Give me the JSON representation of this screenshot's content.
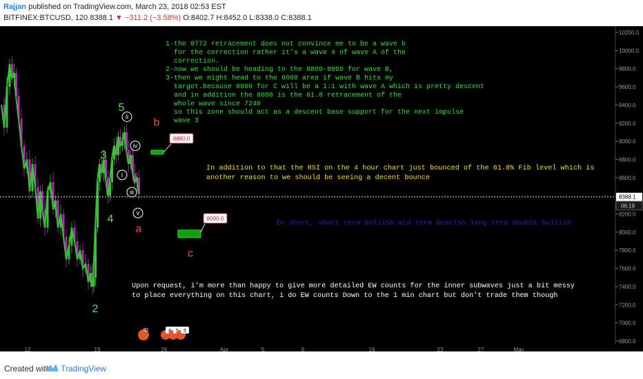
{
  "header": {
    "author": "Rajjan",
    "published": "published on TradingView.com, March 23, 2018 02:53 EST",
    "symbol": "BITFINEX:BTCUSD, 120",
    "last": "8388.1",
    "change": "−311.2 (−3.58%)",
    "ohlc": "O:8402.7 H:8452.0 L:8338.0 C:8388.1"
  },
  "footer": {
    "created_with": "Created with",
    "brand": "TradingView"
  },
  "colors": {
    "background": "#000000",
    "price_line": "#34c334",
    "wave_label": "#55e055",
    "red_label": "#ff4040",
    "note_green": "#33e333",
    "note_yellow": "#f2e21a",
    "note_blue": "#2222cc",
    "note_white": "#ffffff",
    "box_green": "#10a010"
  },
  "chart_data": {
    "type": "line",
    "title": "",
    "y_axis": {
      "ylim": [
        6800,
        10200
      ],
      "tick_labels": [
        "10200.0",
        "10000.0",
        "9800.0",
        "9600.0",
        "9400.0",
        "9200.0",
        "9000.0",
        "8800.0",
        "8600.0",
        "8400.0",
        "8200.0",
        "8000.0",
        "7800.0",
        "7600.0",
        "7400.0",
        "7200.0",
        "7000.0",
        "6800.0"
      ],
      "current_price_label": "8388.1",
      "countdown_label": "06:19"
    },
    "x_axis": {
      "tick_labels": [
        "12",
        "19",
        "26",
        "Apr",
        "5",
        "9",
        "16",
        "23",
        "27",
        "May"
      ]
    },
    "current_price": 8388.1,
    "series": [
      {
        "values": [
          [
            2,
            9400
          ],
          [
            6,
            9150
          ],
          [
            10,
            9600
          ],
          [
            14,
            9850
          ],
          [
            17,
            9700
          ],
          [
            20,
            9750
          ],
          [
            23,
            9500
          ],
          [
            27,
            9250
          ],
          [
            31,
            8950
          ],
          [
            35,
            8700
          ],
          [
            39,
            8800
          ],
          [
            43,
            8450
          ],
          [
            47,
            8750
          ],
          [
            51,
            8500
          ],
          [
            55,
            8150
          ],
          [
            58,
            8450
          ],
          [
            61,
            8250
          ],
          [
            65,
            8050
          ],
          [
            69,
            8450
          ],
          [
            73,
            8550
          ],
          [
            77,
            8250
          ],
          [
            80,
            8350
          ],
          [
            84,
            8050
          ],
          [
            88,
            8200
          ],
          [
            92,
            7950
          ],
          [
            96,
            7700
          ],
          [
            100,
            7850
          ],
          [
            104,
            8050
          ],
          [
            108,
            7900
          ],
          [
            112,
            7700
          ],
          [
            116,
            7800
          ],
          [
            120,
            7600
          ],
          [
            124,
            7650
          ],
          [
            128,
            7450
          ],
          [
            131,
            7550
          ],
          [
            133,
            7400
          ],
          [
            135,
            7500
          ],
          [
            138,
            8050
          ],
          [
            141,
            8550
          ],
          [
            144,
            8750
          ],
          [
            147,
            8650
          ],
          [
            150,
            8800
          ],
          [
            153,
            8600
          ],
          [
            156,
            8400
          ],
          [
            159,
            8550
          ],
          [
            162,
            8800
          ],
          [
            165,
            8950
          ],
          [
            168,
            8850
          ],
          [
            171,
            9050
          ],
          [
            174,
            8950
          ],
          [
            177,
            9000
          ],
          [
            180,
            9100
          ],
          [
            183,
            8900
          ],
          [
            186,
            8750
          ],
          [
            189,
            8850
          ],
          [
            192,
            8650
          ],
          [
            195,
            8550
          ],
          [
            198,
            8600
          ],
          [
            201,
            8420
          ]
        ]
      }
    ],
    "wave_labels": [
      {
        "text": "5",
        "price": 9335,
        "style": "green"
      },
      {
        "text": "3",
        "price": 8810,
        "style": "green"
      },
      {
        "text": "4",
        "price": 8110,
        "style": "green"
      },
      {
        "text": "2",
        "price": 7120,
        "style": "green"
      },
      {
        "text": "ii",
        "price": 9240,
        "style": "circle"
      },
      {
        "text": "iv",
        "price": 8920,
        "style": "circle"
      },
      {
        "text": "i",
        "price": 8600,
        "style": "circle"
      },
      {
        "text": "iii",
        "price": 8410,
        "style": "circle"
      },
      {
        "text": "v",
        "price": 8180,
        "style": "circle"
      },
      {
        "text": "a",
        "price": 8000,
        "style": "red"
      },
      {
        "text": "b",
        "price": 9170,
        "style": "red"
      },
      {
        "text": "c",
        "price": 7730,
        "style": "red"
      }
    ],
    "price_boxes": [
      {
        "label": "8880.0",
        "price": 8880
      },
      {
        "label": "8000.0",
        "price": 8000
      }
    ],
    "event_markers": [
      "30",
      "4",
      "5",
      "5"
    ],
    "notes": {
      "green": [
        "1-the 8772 retracement does not convince me to be a wave b",
        "  for the correction rather it's a wave 4 of wave A of the",
        "  correction.",
        "2-now we should be heading to the 8800-8900 for wave B,",
        "3-then we might head to the 8000 area if wave B hits my",
        "  target.because 8000 for C will be a 1:1 with wave A which is pretty descent",
        "  and in addition the 8000 is the 61.8 retracement of the",
        "  whole wave since 7240",
        "  so this zone should act as a descent base support for the next impulse",
        "  wave 3"
      ],
      "yellow": [
        "In addition to that the RSI on the 4 hour chart just bounced of the 61.8% Fib level which is",
        "another reason to we should be seeing a decent bounce"
      ],
      "blue": "In short, short term bullish mid term bearish long term double bullish",
      "white": [
        "Upon request, i'm more than happy to give more detailed EW counts for the inner subwaves just a bit messy",
        "to place everything on this chart, i do EW counts Down to the 1 min chart but don't trade them though"
      ]
    }
  }
}
